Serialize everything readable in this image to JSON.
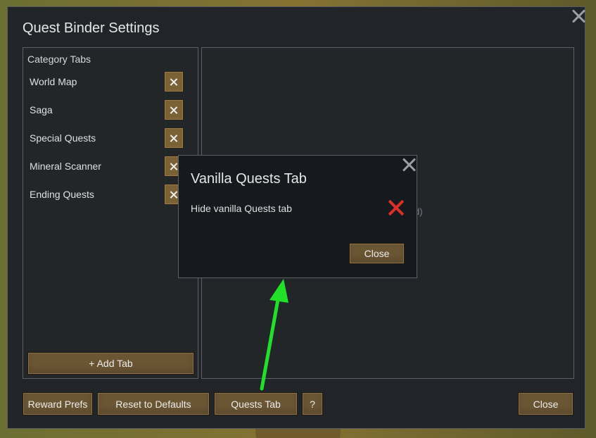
{
  "main": {
    "title": "Quest Binder Settings",
    "category_header": "Category Tabs",
    "tabs": [
      {
        "label": "World Map"
      },
      {
        "label": "Saga"
      },
      {
        "label": "Special Quests"
      },
      {
        "label": "Mineral Scanner"
      },
      {
        "label": "Ending Quests"
      }
    ],
    "add_tab_label": "+ Add Tab",
    "behind_text": "d)"
  },
  "footer": {
    "reward_prefs": "Reward Prefs",
    "reset_defaults": "Reset to Defaults",
    "quests_tab": "Quests Tab",
    "help": "?",
    "close": "Close"
  },
  "dialog": {
    "title": "Vanilla Quests Tab",
    "option_label": "Hide vanilla Quests tab",
    "option_state": "off",
    "close_label": "Close"
  },
  "colors": {
    "window_bg": "#212429",
    "button_bg": "#6b5634",
    "checkbox_off": "#d9312a",
    "annotation_arrow": "#22e02a"
  },
  "icons": {
    "window_close": "close-icon",
    "tab_remove": "close-icon",
    "option_state": "red-x-icon"
  }
}
